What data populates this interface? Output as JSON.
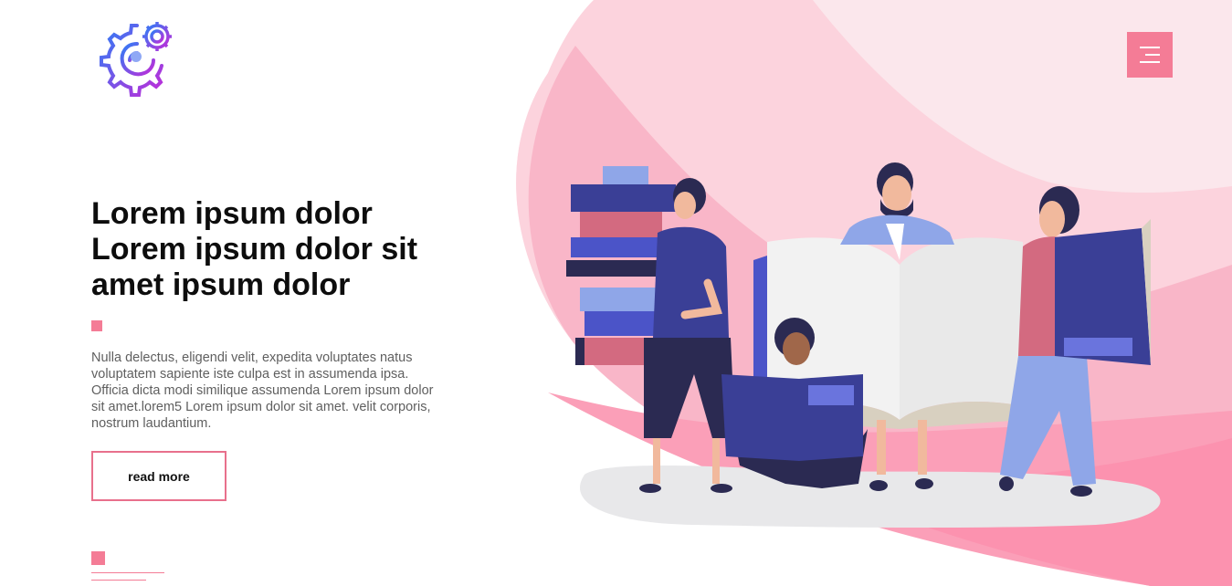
{
  "header": {
    "logo_icon": "gears-logo-icon",
    "menu_icon": "hamburger-menu-icon",
    "accent_color": "#f47c96"
  },
  "hero": {
    "title_line1": "Lorem ipsum dolor",
    "title_line2": "Lorem ipsum dolor sit",
    "title_line3": "amet ipsum dolor",
    "body": "Nulla delectus, eligendi velit, expedita voluptates natus voluptatem sapiente iste culpa est in assumenda ipsa. Officia dicta modi similique assumenda Lorem ipsum dolor sit amet.lorem5 Lorem ipsum dolor sit amet. velit corporis, nostrum laudantium.",
    "button_label": "read more"
  },
  "illustration": {
    "icon": "people-reading-books-illustration"
  }
}
